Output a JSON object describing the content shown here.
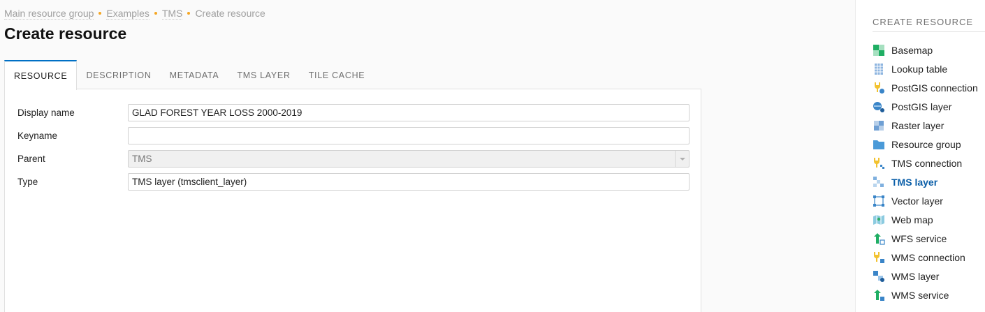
{
  "breadcrumb": {
    "items": [
      "Main resource group",
      "Examples",
      "TMS"
    ],
    "current": "Create resource"
  },
  "page": {
    "title": "Create resource"
  },
  "tabs": [
    {
      "label": "RESOURCE",
      "active": true
    },
    {
      "label": "DESCRIPTION",
      "active": false
    },
    {
      "label": "METADATA",
      "active": false
    },
    {
      "label": "TMS LAYER",
      "active": false
    },
    {
      "label": "TILE CACHE",
      "active": false
    }
  ],
  "form": {
    "display_name": {
      "label": "Display name",
      "value": "GLAD FOREST YEAR LOSS 2000-2019"
    },
    "keyname": {
      "label": "Keyname",
      "value": ""
    },
    "parent": {
      "label": "Parent",
      "value": "TMS"
    },
    "type": {
      "label": "Type",
      "value": "TMS layer (tmsclient_layer)"
    }
  },
  "sidebar": {
    "title": "CREATE RESOURCE",
    "items": [
      {
        "label": "Basemap",
        "icon": "basemap-icon"
      },
      {
        "label": "Lookup table",
        "icon": "lookup-table-icon"
      },
      {
        "label": "PostGIS connection",
        "icon": "postgis-connection-icon"
      },
      {
        "label": "PostGIS layer",
        "icon": "postgis-layer-icon"
      },
      {
        "label": "Raster layer",
        "icon": "raster-layer-icon"
      },
      {
        "label": "Resource group",
        "icon": "folder-icon"
      },
      {
        "label": "TMS connection",
        "icon": "tms-connection-icon"
      },
      {
        "label": "TMS layer",
        "icon": "tms-layer-icon",
        "active": true
      },
      {
        "label": "Vector layer",
        "icon": "vector-layer-icon"
      },
      {
        "label": "Web map",
        "icon": "web-map-icon"
      },
      {
        "label": "WFS service",
        "icon": "wfs-service-icon"
      },
      {
        "label": "WMS connection",
        "icon": "wms-connection-icon"
      },
      {
        "label": "WMS layer",
        "icon": "wms-layer-icon"
      },
      {
        "label": "WMS service",
        "icon": "wms-service-icon"
      }
    ]
  },
  "colors": {
    "accent": "#0070c5",
    "breadcrumb_separator": "#f5a623",
    "active_sidebar": "#0a5ea8"
  }
}
